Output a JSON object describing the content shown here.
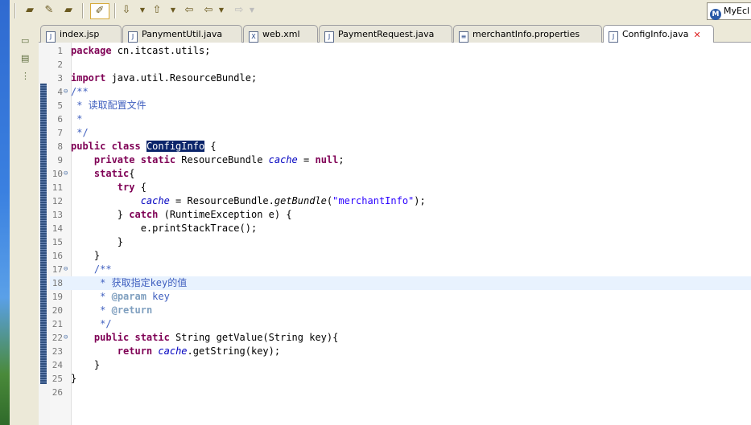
{
  "tabs": [
    {
      "label": "index.jsp",
      "icon": "jsp-file-icon",
      "active": false
    },
    {
      "label": "PanymentUtil.java",
      "icon": "java-file-icon",
      "active": false
    },
    {
      "label": "web.xml",
      "icon": "xml-file-icon",
      "active": false
    },
    {
      "label": "PaymentRequest.java",
      "icon": "java-file-icon",
      "active": false
    },
    {
      "label": "merchantInfo.properties",
      "icon": "properties-file-icon",
      "active": false
    },
    {
      "label": "ConfigInfo.java",
      "icon": "java-file-icon",
      "active": true
    }
  ],
  "perspective_label": "MyEcl",
  "line_numbers": [
    "1",
    "2",
    "3",
    "4",
    "5",
    "6",
    "7",
    "8",
    "9",
    "10",
    "11",
    "12",
    "13",
    "14",
    "15",
    "16",
    "17",
    "18",
    "19",
    "20",
    "21",
    "22",
    "23",
    "24",
    "25",
    "26"
  ],
  "code": {
    "l1_kw": "package",
    "l1_rest": " cn.itcast.utils;",
    "l3_kw": "import",
    "l3_rest": " java.util.ResourceBundle;",
    "l4": "/**",
    "l5": " * 读取配置文件",
    "l6": " *",
    "l7": " */",
    "l8_kw": "public class",
    "l8_sel": "ConfigInfo",
    "l8_rest": " {",
    "l9_kw": "private static",
    "l9_type": " ResourceBundle ",
    "l9_field": "cache",
    "l9_eq": " = ",
    "l9_null": "null",
    "l9_end": ";",
    "l10_kw": "static",
    "l10_rest": "{",
    "l11_kw": "try",
    "l11_rest": " {",
    "l12_field": "cache",
    "l12_mid": " = ResourceBundle.",
    "l12_method": "getBundle",
    "l12_paren": "(",
    "l12_str": "\"merchantInfo\"",
    "l12_end": ");",
    "l13_pre": "} ",
    "l13_kw": "catch",
    "l13_rest": " (RuntimeException e) {",
    "l14": "e.printStackTrace();",
    "l15": "}",
    "l16": "}",
    "l17": "/**",
    "l18": " * 获取指定key的值",
    "l19_pre": " * ",
    "l19_tag": "@param",
    "l19_rest": " key",
    "l20_pre": " * ",
    "l20_tag": "@return",
    "l21": " */",
    "l22_kw": "public static",
    "l22_rest": " String getValue(String key){",
    "l23_kw": "return",
    "l23_sp": " ",
    "l23_field": "cache",
    "l23_rest": ".getString(key);",
    "l24": "}",
    "l25": "}"
  },
  "colors": {
    "keyword": "#7f0055",
    "comment": "#3f5fbf",
    "string": "#2a00ff",
    "field": "#0000c0",
    "selection": "#0a246a",
    "current_line": "#e8f2fe"
  }
}
